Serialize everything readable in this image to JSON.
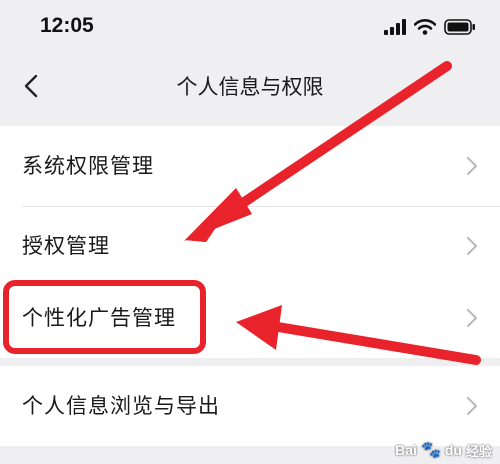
{
  "status_bar": {
    "time": "12:05"
  },
  "nav": {
    "title": "个人信息与权限"
  },
  "groups": [
    {
      "items": [
        {
          "label": "系统权限管理"
        },
        {
          "label": "授权管理"
        }
      ]
    },
    {
      "items": [
        {
          "label": "个性化广告管理",
          "highlighted": true
        }
      ]
    },
    {
      "items": [
        {
          "label": "个人信息浏览与导出"
        }
      ]
    }
  ],
  "watermark": {
    "brand": "Bai",
    "brand2": "du",
    "suffix": "经验"
  },
  "colors": {
    "annotation_red": "#e8232b",
    "background": "#efeff1",
    "chevron": "#b8b8bc"
  }
}
